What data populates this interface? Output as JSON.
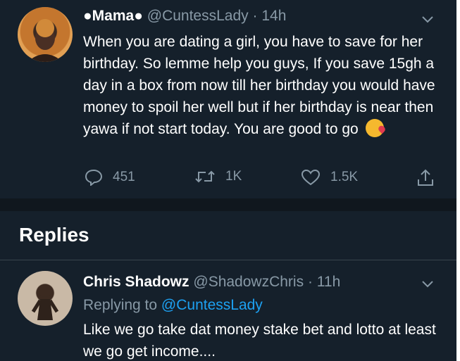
{
  "tweet": {
    "display_name": "●Mama●",
    "handle": "@CuntessLady",
    "separator": "·",
    "time": "14h",
    "text": "When you are dating a girl, you have to save for her birthday. So lemme help you guys, If you save 15gh a day in a box from now till her birthday you would have money to spoil her well but if her birthday is near then yawa if not start today. You are good to go",
    "emoji_icon": "face-blowing-kiss-icon",
    "actions": {
      "replies": "451",
      "retweets": "1K",
      "likes": "1.5K"
    }
  },
  "replies_section": {
    "title": "Replies"
  },
  "reply": {
    "display_name": "Chris Shadowz",
    "handle": "@ShadowzChris",
    "separator": "·",
    "time": "11h",
    "replying_prefix": "Replying to",
    "replying_to": "@CuntessLady",
    "text": "Like we go take dat money stake bet and lotto at least we go get income...."
  },
  "colors": {
    "background": "#15202b",
    "muted": "#8899a6",
    "link": "#1da1f2",
    "text": "#ffffff"
  }
}
